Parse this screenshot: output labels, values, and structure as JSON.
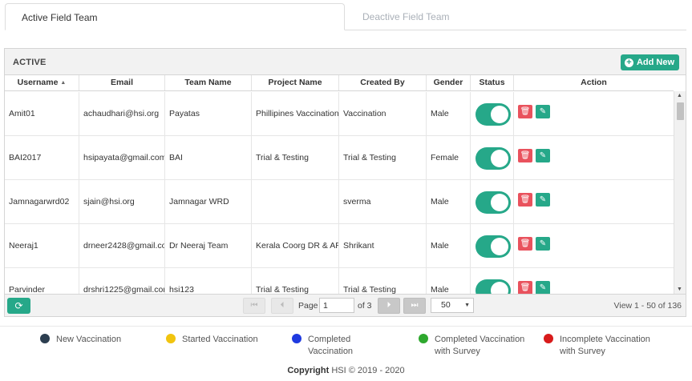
{
  "tabs": [
    {
      "label": "Active Field Team",
      "active": true
    },
    {
      "label": "Deactive Field Team",
      "active": false
    }
  ],
  "panel": {
    "title": "ACTIVE",
    "add_button": "Add New"
  },
  "columns": [
    "Username",
    "Email",
    "Team Name",
    "Project Name",
    "Created By",
    "Gender",
    "Status",
    "Action"
  ],
  "rows": [
    {
      "username": "Amit01",
      "email": "achaudhari@hsi.org",
      "team": "Payatas",
      "project": "Phillipines Vaccination",
      "created_by": "Vaccination",
      "gender": "Male",
      "status": true
    },
    {
      "username": "BAI2017",
      "email": "hsipayata@gmail.com",
      "team": "BAI",
      "project": "Trial & Testing",
      "created_by": "Trial & Testing",
      "gender": "Female",
      "status": true
    },
    {
      "username": "Jamnagarwrd02",
      "email": "sjain@hsi.org",
      "team": "Jamnagar WRD",
      "project": "",
      "created_by": "sverma",
      "gender": "Male",
      "status": true
    },
    {
      "username": "Neeraj1",
      "email": "drneer2428@gmail.co",
      "team": "Dr Neeraj Team",
      "project": "Kerala Coorg DR & AR",
      "created_by": "Shrikant",
      "gender": "Male",
      "status": true
    },
    {
      "username": "Parvinder",
      "email": "drshri1225@gmail.cor",
      "team": "hsi123",
      "project": "Trial & Testing",
      "created_by": "Trial & Testing",
      "gender": "Male",
      "status": true
    }
  ],
  "pager": {
    "page_label": "Page",
    "page_value": "1",
    "of_label": "of 3",
    "page_size": "50",
    "view_text": "View 1 - 50 of 136"
  },
  "legend": [
    {
      "label": "New Vaccination",
      "color": "#2c3e50"
    },
    {
      "label": "Started Vaccination",
      "color": "#f1c40f"
    },
    {
      "label": "Completed Vaccination",
      "color": "#1f3ae0"
    },
    {
      "label": "Completed Vaccination with Survey",
      "color": "#2ea82e"
    },
    {
      "label": "Incomplete Vaccination with Survey",
      "color": "#d81b1b"
    }
  ],
  "footer": {
    "copyright_label": "Copyright",
    "copyright_text": "HSI © 2019 - 2020"
  },
  "icons": {
    "add": "plus-circle-icon",
    "sort": "sort-asc-icon",
    "delete": "trash-icon",
    "edit": "edit-icon",
    "refresh": "refresh-icon",
    "first": "first-page-icon",
    "prev": "prev-page-icon",
    "next": "next-page-icon",
    "last": "last-page-icon"
  },
  "colors": {
    "accent": "#26a889",
    "danger": "#e9525d"
  }
}
